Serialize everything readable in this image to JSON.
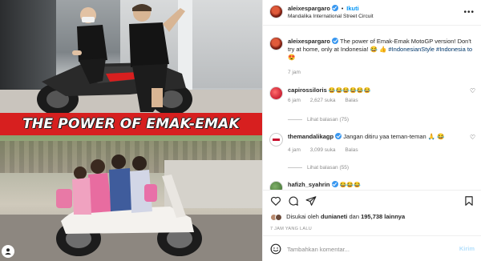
{
  "photo": {
    "caption": "THE POWER OF EMAK-EMAK"
  },
  "header": {
    "username": "aleixespargaro",
    "dot": "•",
    "follow_label": "Ikuti",
    "location": "Mandalika International Street Circuit",
    "more_icon": "more-horizontal-icon"
  },
  "post": {
    "username": "aleixespargaro",
    "text": "The power of Emak-Emak MotoGP version! Don't try at home, only at Indonesia! 😂 👍",
    "hashtags": "#IndonesianStyle #Indonesia to 😍",
    "time": "7 jam"
  },
  "comments": [
    {
      "username": "capirossiloris",
      "text": "😂😂😂😂😂😂",
      "time": "6 jam",
      "likes": "2,627 suka",
      "reply": "Balas",
      "replies": "Lihat balasan (75)"
    },
    {
      "username": "themandalikagp",
      "text": "Jangan ditiru yaa teman-teman 🙏 😂",
      "time": "4 jam",
      "likes": "3,099 suka",
      "reply": "Balas",
      "replies": "Lihat balasan (55)"
    },
    {
      "username": "hafizh_syahrin",
      "text": "😂😂😂"
    }
  ],
  "actions": {
    "liked_by_prefix": "Disukai oleh",
    "liked_by_user": "dunianeti",
    "liked_by_and": "dan",
    "liked_by_count": "195,738 lainnya",
    "time_ago": "7 JAM YANG LALU",
    "comment_placeholder": "Tambahkan komentar...",
    "post_label": "Kirim"
  },
  "colors": {
    "accent": "#0095f6",
    "caption_bar": "#d71f1f",
    "verified": "#3897f0"
  }
}
